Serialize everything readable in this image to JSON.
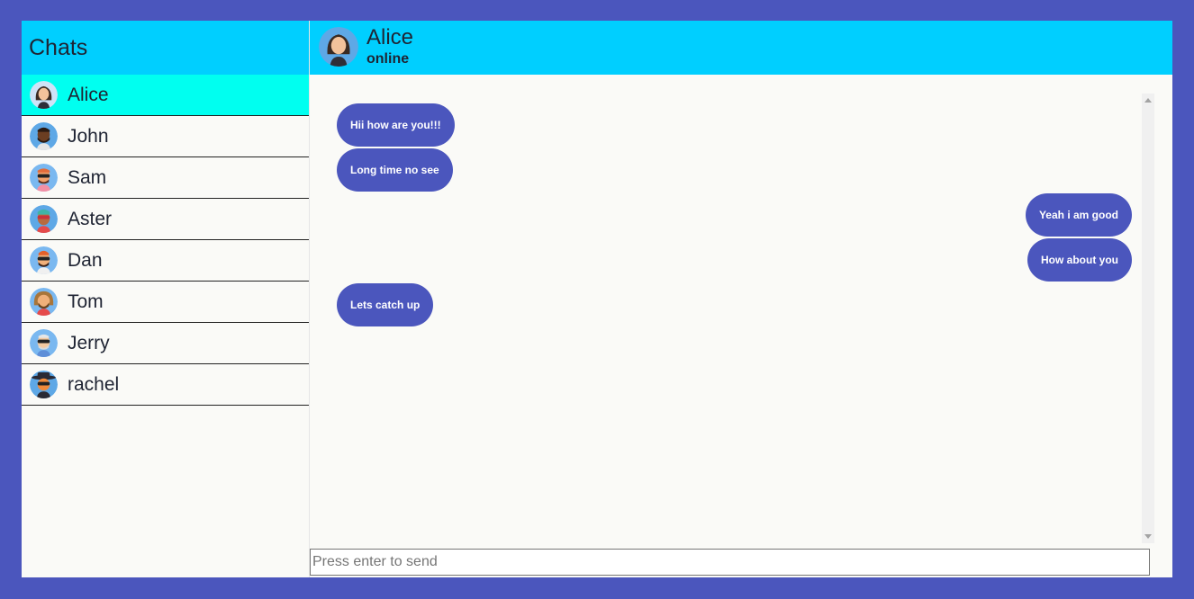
{
  "sidebar": {
    "title": "Chats",
    "contacts": [
      {
        "name": "Alice",
        "avatar": "avatar-alice-icon",
        "active": true
      },
      {
        "name": "John",
        "avatar": "avatar-john-icon"
      },
      {
        "name": "Sam",
        "avatar": "avatar-sam-icon"
      },
      {
        "name": "Aster",
        "avatar": "avatar-aster-icon"
      },
      {
        "name": "Dan",
        "avatar": "avatar-dan-icon"
      },
      {
        "name": "Tom",
        "avatar": "avatar-tom-icon"
      },
      {
        "name": "Jerry",
        "avatar": "avatar-jerry-icon"
      },
      {
        "name": "rachel",
        "avatar": "avatar-rachel-icon"
      }
    ]
  },
  "chat": {
    "name": "Alice",
    "status": "online",
    "messages": [
      {
        "text": "Hii how are you!!!",
        "side": "received"
      },
      {
        "text": "Long time no see",
        "side": "received"
      },
      {
        "text": "Yeah i am good",
        "side": "sent"
      },
      {
        "text": "How about you",
        "side": "sent"
      },
      {
        "text": "Lets catch up",
        "side": "received"
      }
    ]
  },
  "composer": {
    "placeholder": "Press enter to send",
    "value": ""
  },
  "colors": {
    "background": "#4b56bd",
    "header": "#00cfff",
    "active_contact": "#00fff0",
    "bubble": "#4b56bd"
  }
}
